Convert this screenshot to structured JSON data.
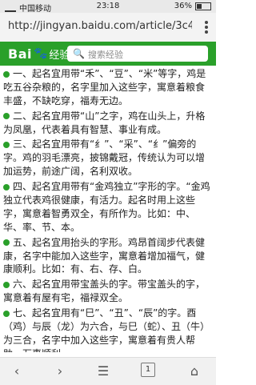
{
  "status": {
    "carrier": "中国移动",
    "time": "23:18",
    "battery": "36%"
  },
  "url": "http://jingyan.baidu.com/article/3c48dd347...",
  "header": {
    "logo_main": "Bai",
    "logo_paw": "🐾",
    "logo_suffix": "经验",
    "search_placeholder": "搜索经验"
  },
  "paragraphs": [
    "一、起名宜用带“禾”、“豆”、“米”等字，鸡是吃五谷杂粮的，名字里加入这些字，寓意着粮食丰盛，不缺吃穿，福寿无边。",
    "二、起名宜用带“山”之字，鸡在山头上，升格为凤凰，代表着具有智慧、事业有成。",
    "三、起名宜用带有“纟”、“采”、“纟”偏旁的字。鸡的羽毛漂亮，披锦戴冠，传统认为可以增加运势，前途广阔，名利双收。",
    "四、起名宜用带有“金鸡独立”字形的字。“金鸡独立代表鸡很健康，有活力。起名时用上这些字，寓意着智勇双全，有所作为。比如：中、华、率、节、本。",
    "五、起名宜用抬头的字形。鸡昂首阔步代表健康，名字中能加入这些字，寓意着增加福气，健康顺利。比如：有、右、存、白。",
    "六、起名宜用带宝盖头的字。带宝盖头的字，寓意着有屋有宅，福禄双全。",
    "七、起名宜用有“巳”、“丑”、“辰”的字。酉（鸡）与辰（龙）为六合，与巳（蛇）、丑（牛）为三合，名字中加入这些字，寓意着有贵人帮助，万事顺利。"
  ],
  "bottom": {
    "tabs_count": "1"
  }
}
